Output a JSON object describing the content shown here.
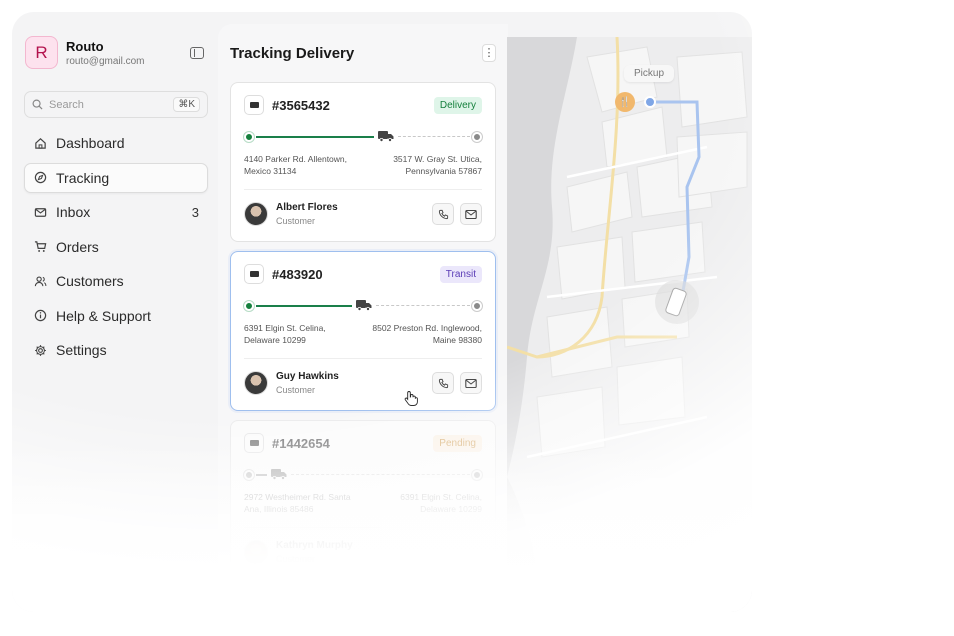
{
  "brand": {
    "initial": "R",
    "name": "Routo",
    "email": "routo@gmail.com"
  },
  "search": {
    "placeholder": "Search",
    "shortcut": "⌘K"
  },
  "nav": {
    "items": [
      {
        "label": "Dashboard",
        "icon": "home-icon",
        "active": false,
        "count": ""
      },
      {
        "label": "Tracking",
        "icon": "compass-icon",
        "active": true,
        "count": ""
      },
      {
        "label": "Inbox",
        "icon": "mail-icon",
        "active": false,
        "count": "3"
      },
      {
        "label": "Orders",
        "icon": "cart-icon",
        "active": false,
        "count": ""
      },
      {
        "label": "Customers",
        "icon": "users-icon",
        "active": false,
        "count": ""
      },
      {
        "label": "Help & Support",
        "icon": "info-icon",
        "active": false,
        "count": ""
      },
      {
        "label": "Settings",
        "icon": "gear-icon",
        "active": false,
        "count": ""
      }
    ]
  },
  "panel": {
    "title": "Tracking Delivery",
    "menu": "⋮"
  },
  "orders": [
    {
      "id": "#3565432",
      "status": "Delivery",
      "progress": 0.55,
      "from_line1": "4140 Parker Rd. Allentown,",
      "from_line2": "Mexico 31134",
      "to_line1": "3517 W. Gray St. Utica,",
      "to_line2": "Pennsylvania 57867",
      "customer": "Albert Flores",
      "role": "Customer"
    },
    {
      "id": "#483920",
      "status": "Transit",
      "progress": 0.45,
      "from_line1": "6391 Elgin St. Celina,",
      "from_line2": "Delaware 10299",
      "to_line1": "8502 Preston Rd. Inglewood,",
      "to_line2": "Maine 98380",
      "customer": "Guy Hawkins",
      "role": "Customer"
    },
    {
      "id": "#1442654",
      "status": "Pending",
      "progress": 0.05,
      "from_line1": "2972 Westheimer Rd. Santa",
      "from_line2": "Ana, Illinois 85486",
      "to_line1": "6391 Elgin St. Celina,",
      "to_line2": "Delaware 10299",
      "customer": "Kathryn Murphy",
      "role": "Customer"
    }
  ],
  "map": {
    "pickup_label": "Pickup"
  },
  "colors": {
    "accent_green": "#15803d",
    "route_blue": "#a9c4ef",
    "road_yellow": "#f3dc9c",
    "water": "#d9d9db"
  }
}
